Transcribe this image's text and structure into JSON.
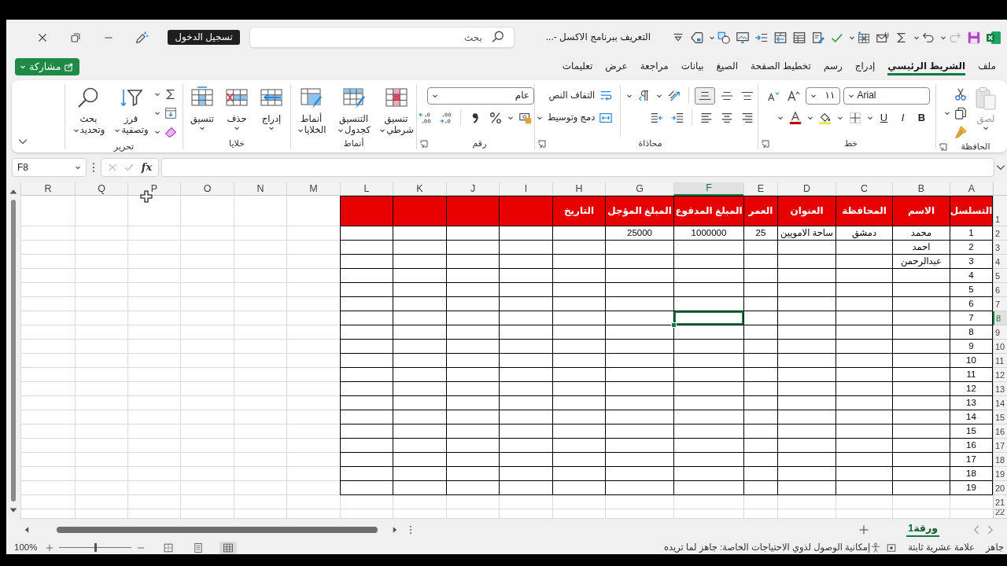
{
  "title_bar": {
    "title": "التعريف ببرنامج الاكسل -...",
    "search": {
      "placeholder": "بحث"
    },
    "sign_in": "تسجيل الدخول",
    "undo": {
      "disabled": false
    },
    "redo": {
      "disabled": true
    }
  },
  "tabs": [
    {
      "label": "ملف",
      "selected": false
    },
    {
      "label": "الشريط الرئيسي",
      "selected": true
    },
    {
      "label": "إدراج",
      "selected": false
    },
    {
      "label": "رسم",
      "selected": false
    },
    {
      "label": "تخطيط الصفحة",
      "selected": false
    },
    {
      "label": "الصيغ",
      "selected": false
    },
    {
      "label": "بيانات",
      "selected": false
    },
    {
      "label": "مراجعة",
      "selected": false
    },
    {
      "label": "عرض",
      "selected": false
    },
    {
      "label": "تعليمات",
      "selected": false
    }
  ],
  "share_button": {
    "label": "مشاركة"
  },
  "ribbon": {
    "groups": [
      {
        "kind": "clipboard",
        "label": "الحافظة",
        "paste": {
          "label": "لصق",
          "disabled": true
        }
      },
      {
        "kind": "font",
        "label": "خط",
        "font_name": "Arial",
        "font_size": "١١",
        "style_buttons": [
          "B",
          "I",
          "U"
        ]
      },
      {
        "kind": "alignment",
        "label": "محاذاة",
        "vertical_align": [
          {
            "selected": false
          },
          {
            "selected": false
          },
          {
            "selected": true
          }
        ],
        "wrap_text": "التفاف النص",
        "merge": "دمج وتوسيط"
      },
      {
        "kind": "number",
        "label": "رقم",
        "format": "عام"
      },
      {
        "kind": "styles",
        "label": "أنماط",
        "buttons": [
          "تنسيق شرطي",
          "التنسيق كجدول",
          "أنماط الخلايا"
        ]
      },
      {
        "kind": "cells",
        "label": "خلايا",
        "buttons": [
          "إدراج",
          "حذف",
          "تنسيق"
        ]
      },
      {
        "kind": "editing",
        "label": "تحرير",
        "buttons": [
          "فرز وتصفية",
          "بحث وتحديد"
        ]
      }
    ]
  },
  "formula_bar": {
    "name_box": "F8",
    "function_label": "fx"
  },
  "sheet": {
    "columns": [
      {
        "label": "A",
        "selected": false,
        "kind": "table"
      },
      {
        "label": "B",
        "selected": false,
        "kind": "table"
      },
      {
        "label": "C",
        "selected": false,
        "kind": "table"
      },
      {
        "label": "D",
        "selected": false,
        "kind": "table"
      },
      {
        "label": "E",
        "selected": false,
        "kind": "table"
      },
      {
        "label": "F",
        "selected": true,
        "kind": "table"
      },
      {
        "label": "G",
        "selected": false,
        "kind": "table"
      },
      {
        "label": "H",
        "selected": false,
        "kind": "table"
      },
      {
        "label": "I",
        "selected": false,
        "kind": "table"
      },
      {
        "label": "J",
        "selected": false,
        "kind": "table"
      },
      {
        "label": "K",
        "selected": false,
        "kind": "table"
      },
      {
        "label": "L",
        "selected": false,
        "kind": "table"
      },
      {
        "label": "M",
        "selected": false,
        "kind": "plain"
      },
      {
        "label": "N",
        "selected": false,
        "kind": "plain"
      },
      {
        "label": "O",
        "selected": false,
        "kind": "plain"
      },
      {
        "label": "P",
        "selected": false,
        "kind": "plain"
      },
      {
        "label": "Q",
        "selected": false,
        "kind": "plain"
      },
      {
        "label": "R",
        "selected": false,
        "kind": "plain"
      }
    ],
    "rows": [
      {
        "number": "1",
        "selected": false,
        "kind": "header",
        "cells": [
          "التسلسل",
          "الاسم",
          "المحافظة",
          "العنوان",
          "العمر",
          "المبلغ المدفوع",
          "المبلغ المؤجل",
          "التاريخ"
        ]
      },
      {
        "number": "2",
        "selected": false,
        "kind": "table",
        "cells": [
          "1",
          "محمد",
          "دمشق",
          "ساحة الامويين",
          "25",
          "1000000",
          "25000"
        ]
      },
      {
        "number": "3",
        "selected": false,
        "kind": "table",
        "cells": [
          "2",
          "احمد"
        ]
      },
      {
        "number": "4",
        "selected": false,
        "kind": "table",
        "cells": [
          "3",
          "عبدالرحمن"
        ]
      },
      {
        "number": "5",
        "selected": false,
        "kind": "table",
        "cells": [
          "4"
        ]
      },
      {
        "number": "6",
        "selected": false,
        "kind": "table",
        "cells": [
          "5"
        ]
      },
      {
        "number": "7",
        "selected": false,
        "kind": "table",
        "cells": [
          "6"
        ]
      },
      {
        "number": "8",
        "selected": true,
        "kind": "table",
        "cells": [
          "7"
        ]
      },
      {
        "number": "9",
        "selected": false,
        "kind": "table",
        "cells": [
          "8"
        ]
      },
      {
        "number": "10",
        "selected": false,
        "kind": "table",
        "cells": [
          "9"
        ]
      },
      {
        "number": "11",
        "selected": false,
        "kind": "table",
        "cells": [
          "10"
        ]
      },
      {
        "number": "12",
        "selected": false,
        "kind": "table",
        "cells": [
          "11"
        ]
      },
      {
        "number": "13",
        "selected": false,
        "kind": "table",
        "cells": [
          "12"
        ]
      },
      {
        "number": "14",
        "selected": false,
        "kind": "table",
        "cells": [
          "13"
        ]
      },
      {
        "number": "15",
        "selected": false,
        "kind": "table",
        "cells": [
          "14"
        ]
      },
      {
        "number": "16",
        "selected": false,
        "kind": "table",
        "cells": [
          "15"
        ]
      },
      {
        "number": "17",
        "selected": false,
        "kind": "table",
        "cells": [
          "16"
        ]
      },
      {
        "number": "18",
        "selected": false,
        "kind": "table",
        "cells": [
          "17"
        ]
      },
      {
        "number": "19",
        "selected": false,
        "kind": "table",
        "cells": [
          "18"
        ]
      },
      {
        "number": "20",
        "selected": false,
        "kind": "table",
        "cells": [
          "19"
        ]
      },
      {
        "number": "21",
        "selected": false,
        "kind": "plain"
      },
      {
        "number": "22",
        "selected": false,
        "kind": "plain"
      }
    ]
  },
  "sheet_tabs": [
    {
      "label": "ورقة1",
      "selected": true
    }
  ],
  "status_bar": {
    "ready": "جاهز",
    "fixed_decimal": "علامة عشرية ثابتة",
    "accessibility": "إمكانية الوصول لذوي الاحتياجات الخاصة: جاهز لما تريده",
    "views": [
      {
        "selected": true
      },
      {
        "selected": false
      },
      {
        "selected": false
      }
    ],
    "zoom": {
      "reading": "100%",
      "level": 0.5
    }
  }
}
